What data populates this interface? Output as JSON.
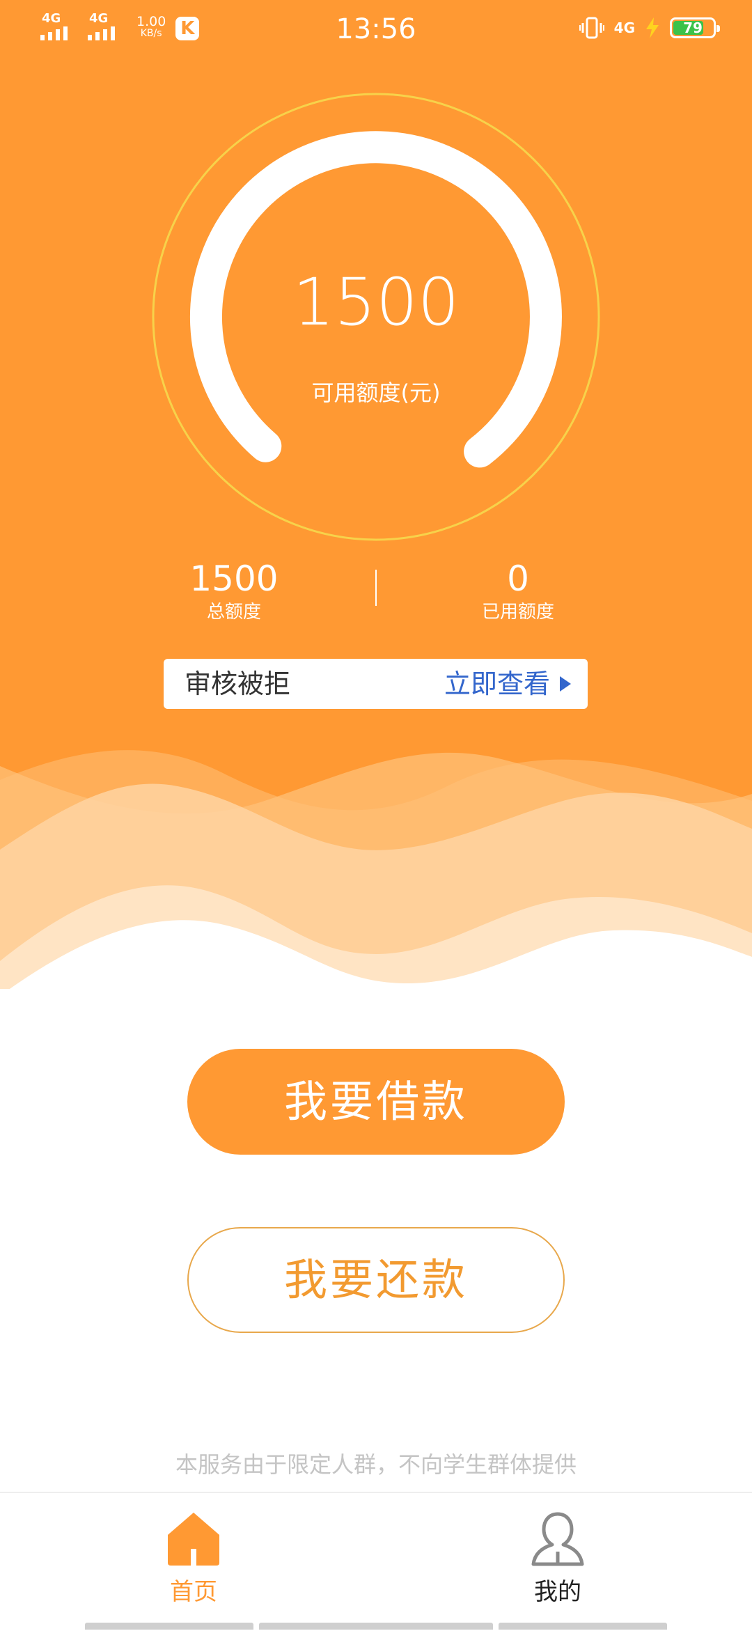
{
  "status_bar": {
    "signal_1_label": "4G",
    "signal_2_label": "4G",
    "speed_value": "1.00",
    "speed_unit": "KB/s",
    "app_badge": "K",
    "time": "13:56",
    "network_right": "4G",
    "battery_level": "79",
    "battery_fraction": 0.79
  },
  "credit": {
    "available_amount": "1500",
    "available_label": "可用额度(元)",
    "total_amount": "1500",
    "total_label": "总额度",
    "used_amount": "0",
    "used_label": "已用额度"
  },
  "review": {
    "status_text": "审核被拒",
    "action_label": "立即查看"
  },
  "actions": {
    "borrow_label": "我要借款",
    "repay_label": "我要还款"
  },
  "disclaimer": "本服务由于限定人群，不向学生群体提供",
  "tabs": [
    {
      "label": "首页",
      "active": true
    },
    {
      "label": "我的",
      "active": false
    }
  ],
  "colors": {
    "primary": "#FF9933",
    "link": "#3366CC",
    "battery": "#3BC24A"
  },
  "icons": {
    "home": "home-icon",
    "profile": "user-icon",
    "arrow": "play-arrow-icon"
  }
}
